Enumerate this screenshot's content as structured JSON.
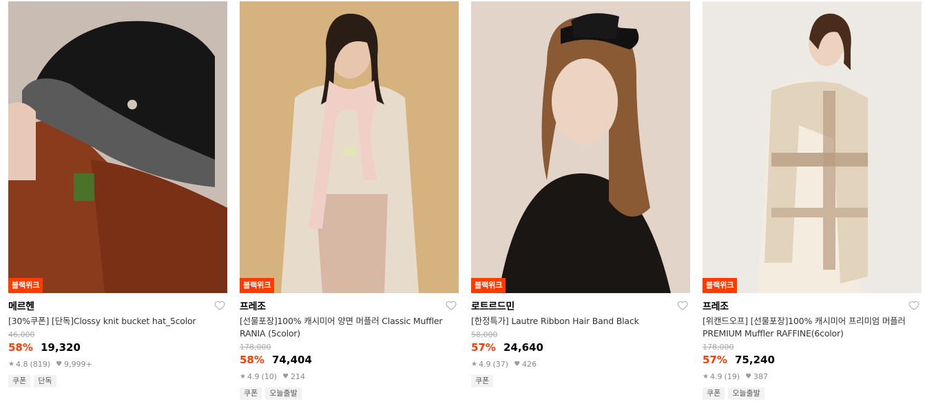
{
  "products": [
    {
      "badge": "블랙위크",
      "brand": "메르헨",
      "title": "[30%쿠폰] [단독]Clossy knit bucket hat_5color",
      "original_price": "46,000",
      "discount": "58%",
      "price": "19,320",
      "rating": "4.8",
      "reviews": "(819)",
      "likes": "9,999+",
      "tags": [
        "쿠폰",
        "단독"
      ]
    },
    {
      "badge": "블랙위크",
      "brand": "프레조",
      "title": "[선물포장]100% 캐시미어 양면 머플러 Classic Muffler RANIA (5color)",
      "original_price": "178,000",
      "discount": "58%",
      "price": "74,404",
      "rating": "4.9",
      "reviews": "(10)",
      "likes": "214",
      "tags": [
        "쿠폰",
        "오늘출발"
      ]
    },
    {
      "badge": "블랙위크",
      "brand": "로트르드민",
      "title": "[한정특가] Lautre Ribbon Hair Band Black",
      "original_price": "58,000",
      "discount": "57%",
      "price": "24,640",
      "rating": "4.9",
      "reviews": "(37)",
      "likes": "426",
      "tags": [
        "쿠폰"
      ]
    },
    {
      "badge": "블랙위크",
      "brand": "프레조",
      "title": "[위캔드오프] [선물포장]100% 캐시미어 프리미엄 머플러 PREMIUM Muffler RAFFINE(6color)",
      "original_price": "178,000",
      "discount": "57%",
      "price": "75,240",
      "rating": "4.9",
      "reviews": "(19)",
      "likes": "387",
      "tags": [
        "쿠폰",
        "오늘출발"
      ]
    }
  ],
  "icons": {
    "wishlist": "heart-outline-icon",
    "rating": "star-icon",
    "likes": "heart-icon"
  },
  "colors": {
    "accent": "#ff3c00"
  }
}
